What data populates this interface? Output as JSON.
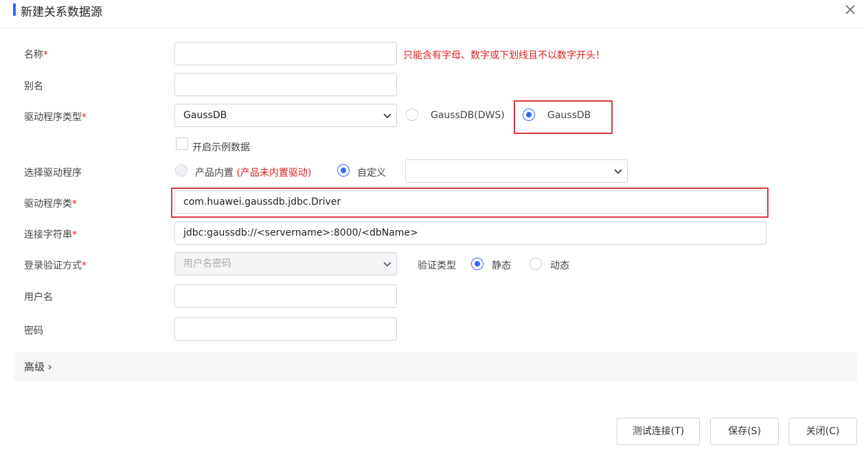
{
  "dialog": {
    "title": "新建关系数据源"
  },
  "form": {
    "name_label": "名称",
    "required_mark": "*",
    "name_value": "",
    "name_error": "只能含有字母、数字或下划线且不以数字开头！",
    "alias_label": "别名",
    "alias_value": "",
    "driver_type_label": "驱动程序类型",
    "driver_type_value": "GaussDB",
    "driver_radio_1": "GaussDB(DWS)",
    "driver_radio_2": "GaussDB",
    "sample_data_label": "开启示例数据",
    "select_driver_label": "选择驱动程序",
    "builtin_label": "产品内置",
    "builtin_note": "(产品未内置驱动)",
    "custom_label": "自定义",
    "custom_value": "",
    "driver_class_label": "驱动程序类",
    "driver_class_value": "com.huawei.gaussdb.jdbc.Driver",
    "conn_string_label": "连接字符串",
    "conn_string_value": "jdbc:gaussdb://<servername>:8000/<dbName>",
    "auth_label": "登录验证方式",
    "auth_value": "用户名密码",
    "verify_type_label": "验证类型",
    "static_label": "静态",
    "dynamic_label": "动态",
    "username_label": "用户名",
    "username_value": "",
    "password_label": "密码",
    "password_value": ""
  },
  "advanced": {
    "label": "高级 ›"
  },
  "buttons": {
    "test": "测试连接(T)",
    "save": "保存(S)",
    "close": "关闭(C)"
  },
  "colors": {
    "accent": "#2f6bff",
    "error": "#e02020",
    "highlight_border": "#d9363e"
  }
}
